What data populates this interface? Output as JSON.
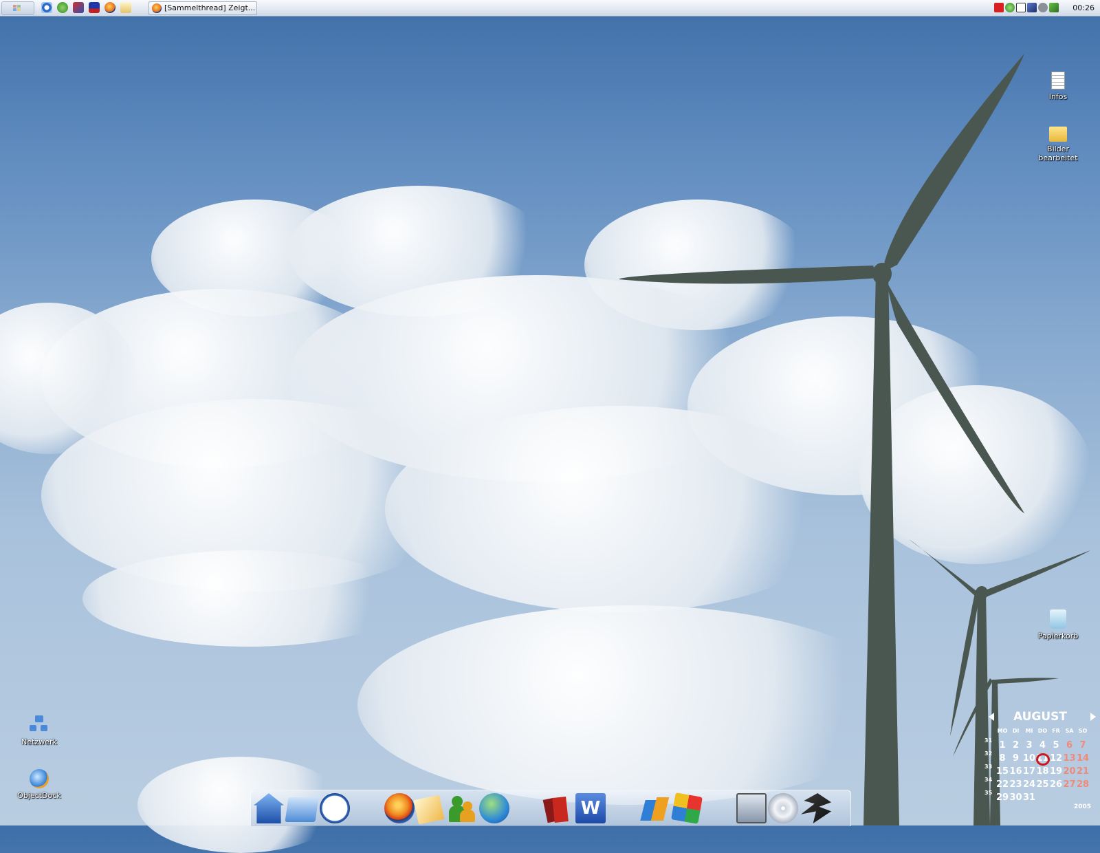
{
  "taskbar": {
    "task_title": "[Sammelthread] Zeigt...",
    "clock": "00:26"
  },
  "desktop_icons": {
    "infos": "Infos",
    "bilder": "Bilder bearbeitet",
    "papierkorb": "Papierkorb",
    "netzwerk": "Netzwerk",
    "objectdock": "ObjectDock"
  },
  "dock_items": [
    "home",
    "folder",
    "clock",
    "firefox",
    "mail",
    "messenger",
    "network",
    "books",
    "word",
    "windows",
    "cube",
    "tools",
    "dvd",
    "winamp"
  ],
  "calendar": {
    "month": "AUGUST",
    "year": "2005",
    "weekdays": [
      "MO",
      "DI",
      "MI",
      "DO",
      "FR",
      "SA",
      "SO"
    ],
    "weeks": [
      "31",
      "32",
      "33",
      "34",
      "35"
    ],
    "days": [
      [
        "1",
        "2",
        "3",
        "4",
        "5",
        "6",
        "7"
      ],
      [
        "8",
        "9",
        "10",
        "11",
        "12",
        "13",
        "14"
      ],
      [
        "15",
        "16",
        "17",
        "18",
        "19",
        "20",
        "21"
      ],
      [
        "22",
        "23",
        "24",
        "25",
        "26",
        "27",
        "28"
      ],
      [
        "29",
        "30",
        "31"
      ]
    ],
    "today": "11"
  },
  "colors": {
    "sky_top": "#3f6fa8",
    "taskbar": "#e3e9f2",
    "weekend": "#f1897a",
    "today_ring": "#d0161d",
    "turbine": "#4a5650"
  }
}
